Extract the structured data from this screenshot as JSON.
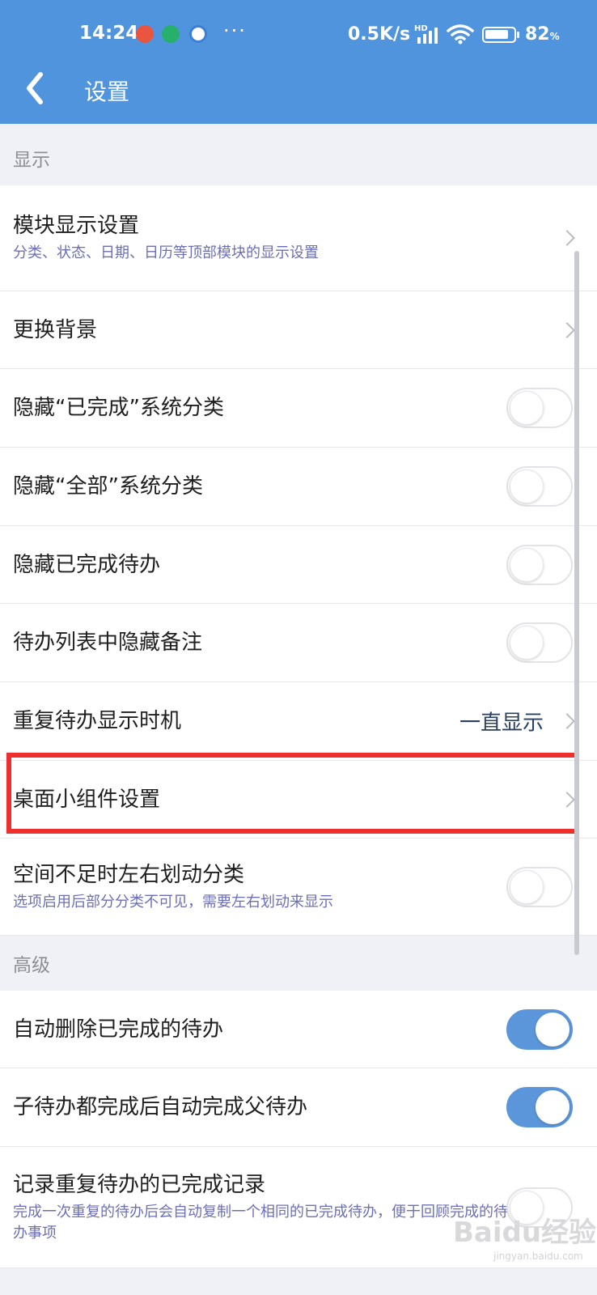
{
  "status_bar": {
    "time": "14:24",
    "dots": "···",
    "net_speed": "0.5K/s",
    "hd_label": "HD",
    "battery_pct": "82",
    "battery_unit": "%"
  },
  "header": {
    "title": "设置"
  },
  "colors": {
    "header_bg": "#4f94dc",
    "accent": "#5b95da",
    "highlight": "#ef2f2d",
    "subtitle": "#6d6fb6"
  },
  "sections": {
    "display": {
      "label": "显示",
      "items": [
        {
          "title": "模块显示设置",
          "subtitle": "分类、状态、日期、日历等顶部模块的显示设置",
          "control": "chevron"
        },
        {
          "title": "更换背景",
          "control": "chevron"
        },
        {
          "title": "隐藏“已完成”系统分类",
          "control": "toggle",
          "on": false
        },
        {
          "title": "隐藏“全部”系统分类",
          "control": "toggle",
          "on": false
        },
        {
          "title": "隐藏已完成待办",
          "control": "toggle",
          "on": false
        },
        {
          "title": "待办列表中隐藏备注",
          "control": "toggle",
          "on": false
        },
        {
          "title": "重复待办显示时机",
          "value": "一直显示",
          "control": "chevron"
        },
        {
          "title": "桌面小组件设置",
          "control": "chevron"
        },
        {
          "title": "空间不足时左右划动分类",
          "subtitle": "选项启用后部分分类不可见，需要左右划动来显示",
          "control": "toggle",
          "on": false
        }
      ]
    },
    "advanced": {
      "label": "高级",
      "items": [
        {
          "title": "自动删除已完成的待办",
          "control": "toggle",
          "on": true
        },
        {
          "title": "子待办都完成后自动完成父待办",
          "control": "toggle",
          "on": true
        },
        {
          "title": "记录重复待办的已完成记录",
          "subtitle": "完成一次重复的待办后会自动复制一个相同的已完成待办，便于回顾完成的待办事项",
          "control": "toggle",
          "on": false
        }
      ]
    }
  },
  "watermark": {
    "text": "Baidu经验",
    "sub": "jingyan.baidu.com"
  }
}
